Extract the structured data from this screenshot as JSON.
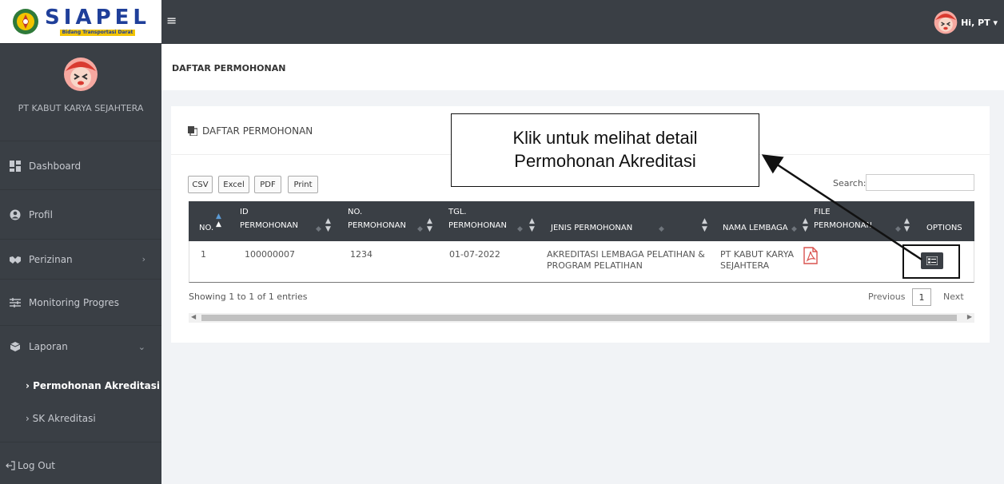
{
  "brand": {
    "name": "SIAPEL",
    "subtitle": "Bidang Transportasi Darat",
    "colors": {
      "primary": "#1f3f9a",
      "accent": "#f3c400"
    }
  },
  "topbar": {
    "menu_icon": "hamburger-icon",
    "greeting": "Hi, PT ▾"
  },
  "sidebar": {
    "company": "PT KABUT KARYA SEJAHTERA",
    "items": [
      {
        "label": "Dashboard",
        "icon": "dashboard-icon"
      },
      {
        "label": "Profil",
        "icon": "user-icon"
      },
      {
        "label": "Perizinan",
        "icon": "handshake-icon",
        "chevron": "›"
      },
      {
        "label": "Monitoring Progres",
        "icon": "sliders-icon"
      },
      {
        "label": "Laporan",
        "icon": "folder-icon",
        "chevron": "⌄"
      }
    ],
    "subitems": [
      {
        "label": "› Permohonan Akreditasi",
        "active": true
      },
      {
        "label": "› SK Akreditasi",
        "active": false
      }
    ],
    "logout": "Log Out"
  },
  "breadcrumb": "DAFTAR PERMOHONAN",
  "panel": {
    "title": "DAFTAR PERMOHONAN",
    "buttons": {
      "csv": "CSV",
      "excel": "Excel",
      "pdf": "PDF",
      "print": "Print"
    },
    "search_label": "Search:",
    "columns": {
      "no": "NO.",
      "id_1": "ID",
      "id_2": "PERMOHONAN",
      "nop_1": "NO.",
      "nop_2": "PERMOHONAN",
      "tgl_1": "TGL.",
      "tgl_2": "PERMOHONAN",
      "jenis": "JENIS PERMOHONAN",
      "lembaga": "NAMA LEMBAGA",
      "file_1": "FILE",
      "file_2": "PERMOHONAN",
      "options": "OPTIONS"
    },
    "rows": [
      {
        "no": "1",
        "id": "100000007",
        "no_permohonan": "1234",
        "tgl": "01-07-2022",
        "jenis_1": "AKREDITASI LEMBAGA PELATIHAN &",
        "jenis_2": "PROGRAM PELATIHAN",
        "lembaga_1": "PT KABUT KARYA",
        "lembaga_2": "SEJAHTERA",
        "file_icon": "pdf-icon",
        "option_icon": "detail-icon"
      }
    ],
    "info": "Showing 1 to 1 of 1 entries",
    "pagination": {
      "previous": "Previous",
      "page": "1",
      "next": "Next"
    }
  },
  "callout": {
    "line1": "Klik untuk melihat detail",
    "line2": "Permohonan Akreditasi"
  }
}
